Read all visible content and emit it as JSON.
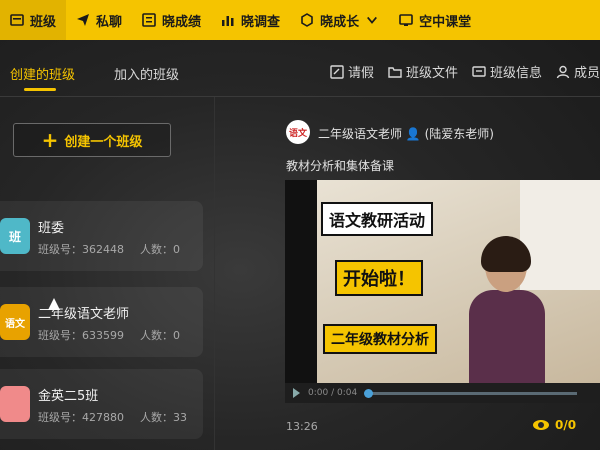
{
  "nav": {
    "items": [
      {
        "label": "班级",
        "icon": "class-icon",
        "active": true
      },
      {
        "label": "私聊",
        "icon": "send-icon"
      },
      {
        "label": "晓成绩",
        "icon": "grade-icon"
      },
      {
        "label": "晓调查",
        "icon": "chart-icon"
      },
      {
        "label": "晓成长",
        "icon": "growth-icon"
      },
      {
        "label": "空中课堂",
        "icon": "classroom-icon"
      }
    ]
  },
  "tabs": {
    "created": "创建的班级",
    "joined": "加入的班级"
  },
  "right_tabs": [
    "请假",
    "班级文件",
    "班级信息",
    "成员"
  ],
  "create_button": {
    "label": "创建一个班级"
  },
  "classes": [
    {
      "name": "班委",
      "id_label": "班级号：362448",
      "count_label": "人数：0",
      "avatar_text": "班",
      "avatar_color": "#4fb8c8"
    },
    {
      "name": "二年级语文老师",
      "id_label": "班级号：633599",
      "count_label": "人数：0",
      "avatar_text": "语文",
      "avatar_color": "#e8a200"
    },
    {
      "name": "金英二5班",
      "id_label": "班级号：427880",
      "count_label": "人数：33",
      "avatar_text": "",
      "avatar_color": "#f08a8a"
    }
  ],
  "post": {
    "author": "二年级语文老师",
    "teacher": "(陆爱东老师)",
    "avatar_text": "语文",
    "title": "教材分析和集体备课",
    "video": {
      "caption_1": "语文教研活动",
      "caption_2": "开始啦！",
      "caption_3": "二年级教材分析",
      "time": "0:00 / 0:04",
      "progress": 0
    },
    "time": "13:26",
    "likes": "0/0"
  },
  "colors": {
    "accent": "#f5c400",
    "background": "#262626"
  }
}
